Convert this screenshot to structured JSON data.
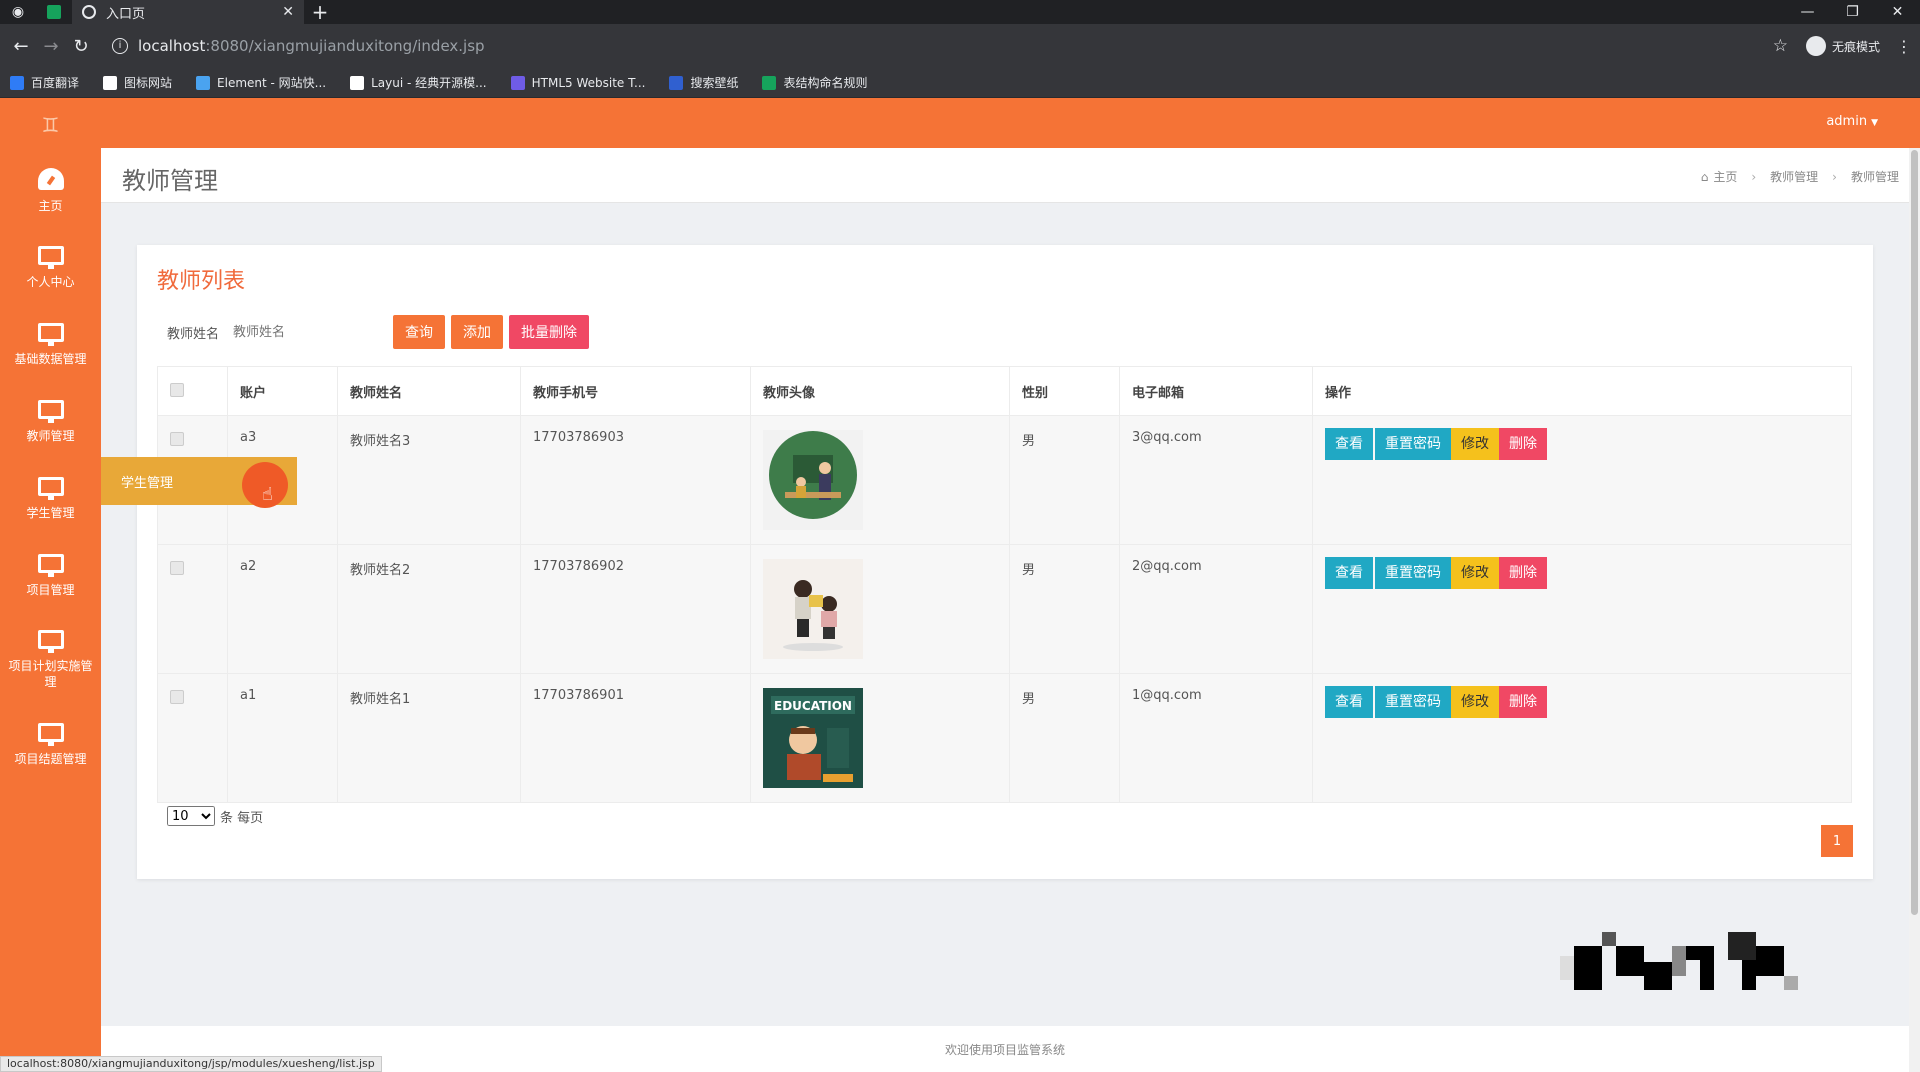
{
  "browser": {
    "tab_title": "入口页",
    "url_host": "localhost",
    "url_path": ":8080/xiangmujianduxitong/index.jsp",
    "incognito_label": "无痕模式",
    "bookmarks": [
      {
        "label": "百度翻译",
        "color": "#2f7cf6"
      },
      {
        "label": "图标网站",
        "color": "#ffffff"
      },
      {
        "label": "Element - 网站快...",
        "color": "#4aa3f0"
      },
      {
        "label": "Layui - 经典开源模...",
        "color": "#ffffff"
      },
      {
        "label": "HTML5 Website T...",
        "color": "#6f5ce6"
      },
      {
        "label": "搜索壁纸",
        "color": "#3060d0"
      },
      {
        "label": "表结构命名规则",
        "color": "#16a35c"
      }
    ]
  },
  "sidebar": {
    "items": [
      {
        "label": "主页",
        "icon": "dashboard-icon"
      },
      {
        "label": "个人中心",
        "icon": "monitor-icon"
      },
      {
        "label": "基础数据管理",
        "icon": "monitor-icon"
      },
      {
        "label": "教师管理",
        "icon": "monitor-icon"
      },
      {
        "label": "学生管理",
        "icon": "monitor-icon"
      },
      {
        "label": "项目管理",
        "icon": "monitor-icon"
      },
      {
        "label": "项目计划实施管理",
        "icon": "monitor-icon"
      },
      {
        "label": "项目结题管理",
        "icon": "monitor-icon"
      }
    ],
    "hover_submenu": "学生管理"
  },
  "topbar": {
    "user": "admin"
  },
  "page": {
    "title": "教师管理",
    "breadcrumb": [
      "主页",
      "教师管理",
      "教师管理"
    ]
  },
  "list": {
    "title": "教师列表",
    "search_label": "教师姓名",
    "search_placeholder": "教师姓名",
    "query_btn": "查询",
    "add_btn": "添加",
    "batch_delete_btn": "批量删除",
    "columns": [
      "账户",
      "教师姓名",
      "教师手机号",
      "教师头像",
      "性别",
      "电子邮箱",
      "操作"
    ],
    "rows": [
      {
        "account": "a3",
        "name": "教师姓名3",
        "phone": "17703786903",
        "gender": "男",
        "email": "3@qq.com"
      },
      {
        "account": "a2",
        "name": "教师姓名2",
        "phone": "17703786902",
        "gender": "男",
        "email": "2@qq.com"
      },
      {
        "account": "a1",
        "name": "教师姓名1",
        "phone": "17703786901",
        "gender": "男",
        "email": "1@qq.com"
      }
    ],
    "ops": {
      "view": "查看",
      "reset": "重置密码",
      "edit": "修改",
      "delete": "删除"
    },
    "page_size": "10",
    "page_size_suffix": "条 每页",
    "current_page": "1"
  },
  "footer": {
    "text": "欢迎使用项目监管系统"
  },
  "statusbar": {
    "url": "localhost:8080/xiangmujianduxitong/jsp/modules/xuesheng/list.jsp"
  },
  "colors": {
    "accent": "#f57336",
    "cyan": "#20a8c4",
    "yellow": "#f5c11c",
    "pink": "#f04864"
  }
}
